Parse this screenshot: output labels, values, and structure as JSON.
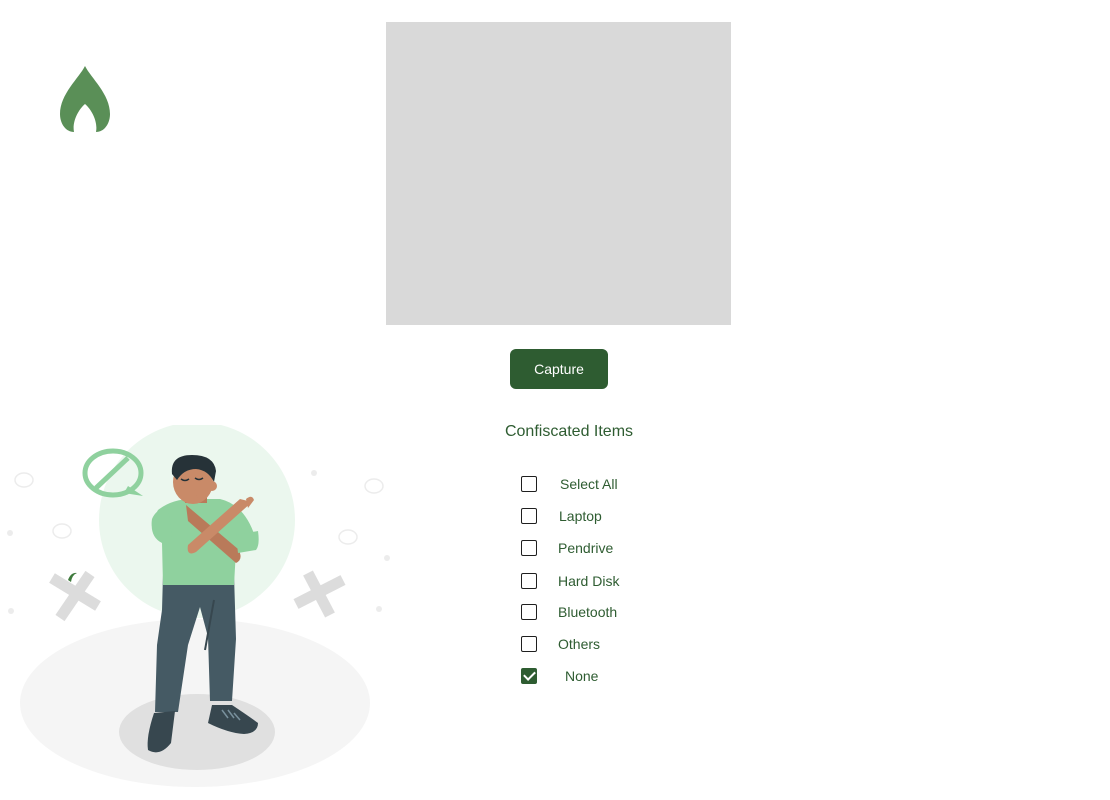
{
  "app": {
    "logo_icon": "flame-leaf-logo",
    "brand_color": "#5a8f57"
  },
  "camera": {
    "preview_color": "#d9d9d9"
  },
  "capture": {
    "label": "Capture",
    "color": "#2e5c31"
  },
  "confiscated": {
    "title": "Confiscated Items",
    "options": [
      {
        "label": "Select All",
        "checked": false
      },
      {
        "label": "Laptop",
        "checked": false
      },
      {
        "label": "Pendrive",
        "checked": false
      },
      {
        "label": "Hard Disk",
        "checked": false
      },
      {
        "label": "Bluetooth",
        "checked": false
      },
      {
        "label": "Others",
        "checked": false
      },
      {
        "label": "None",
        "checked": true
      }
    ]
  },
  "illustration": {
    "icon": "person-crossed-arms-prohibited-illustration"
  }
}
